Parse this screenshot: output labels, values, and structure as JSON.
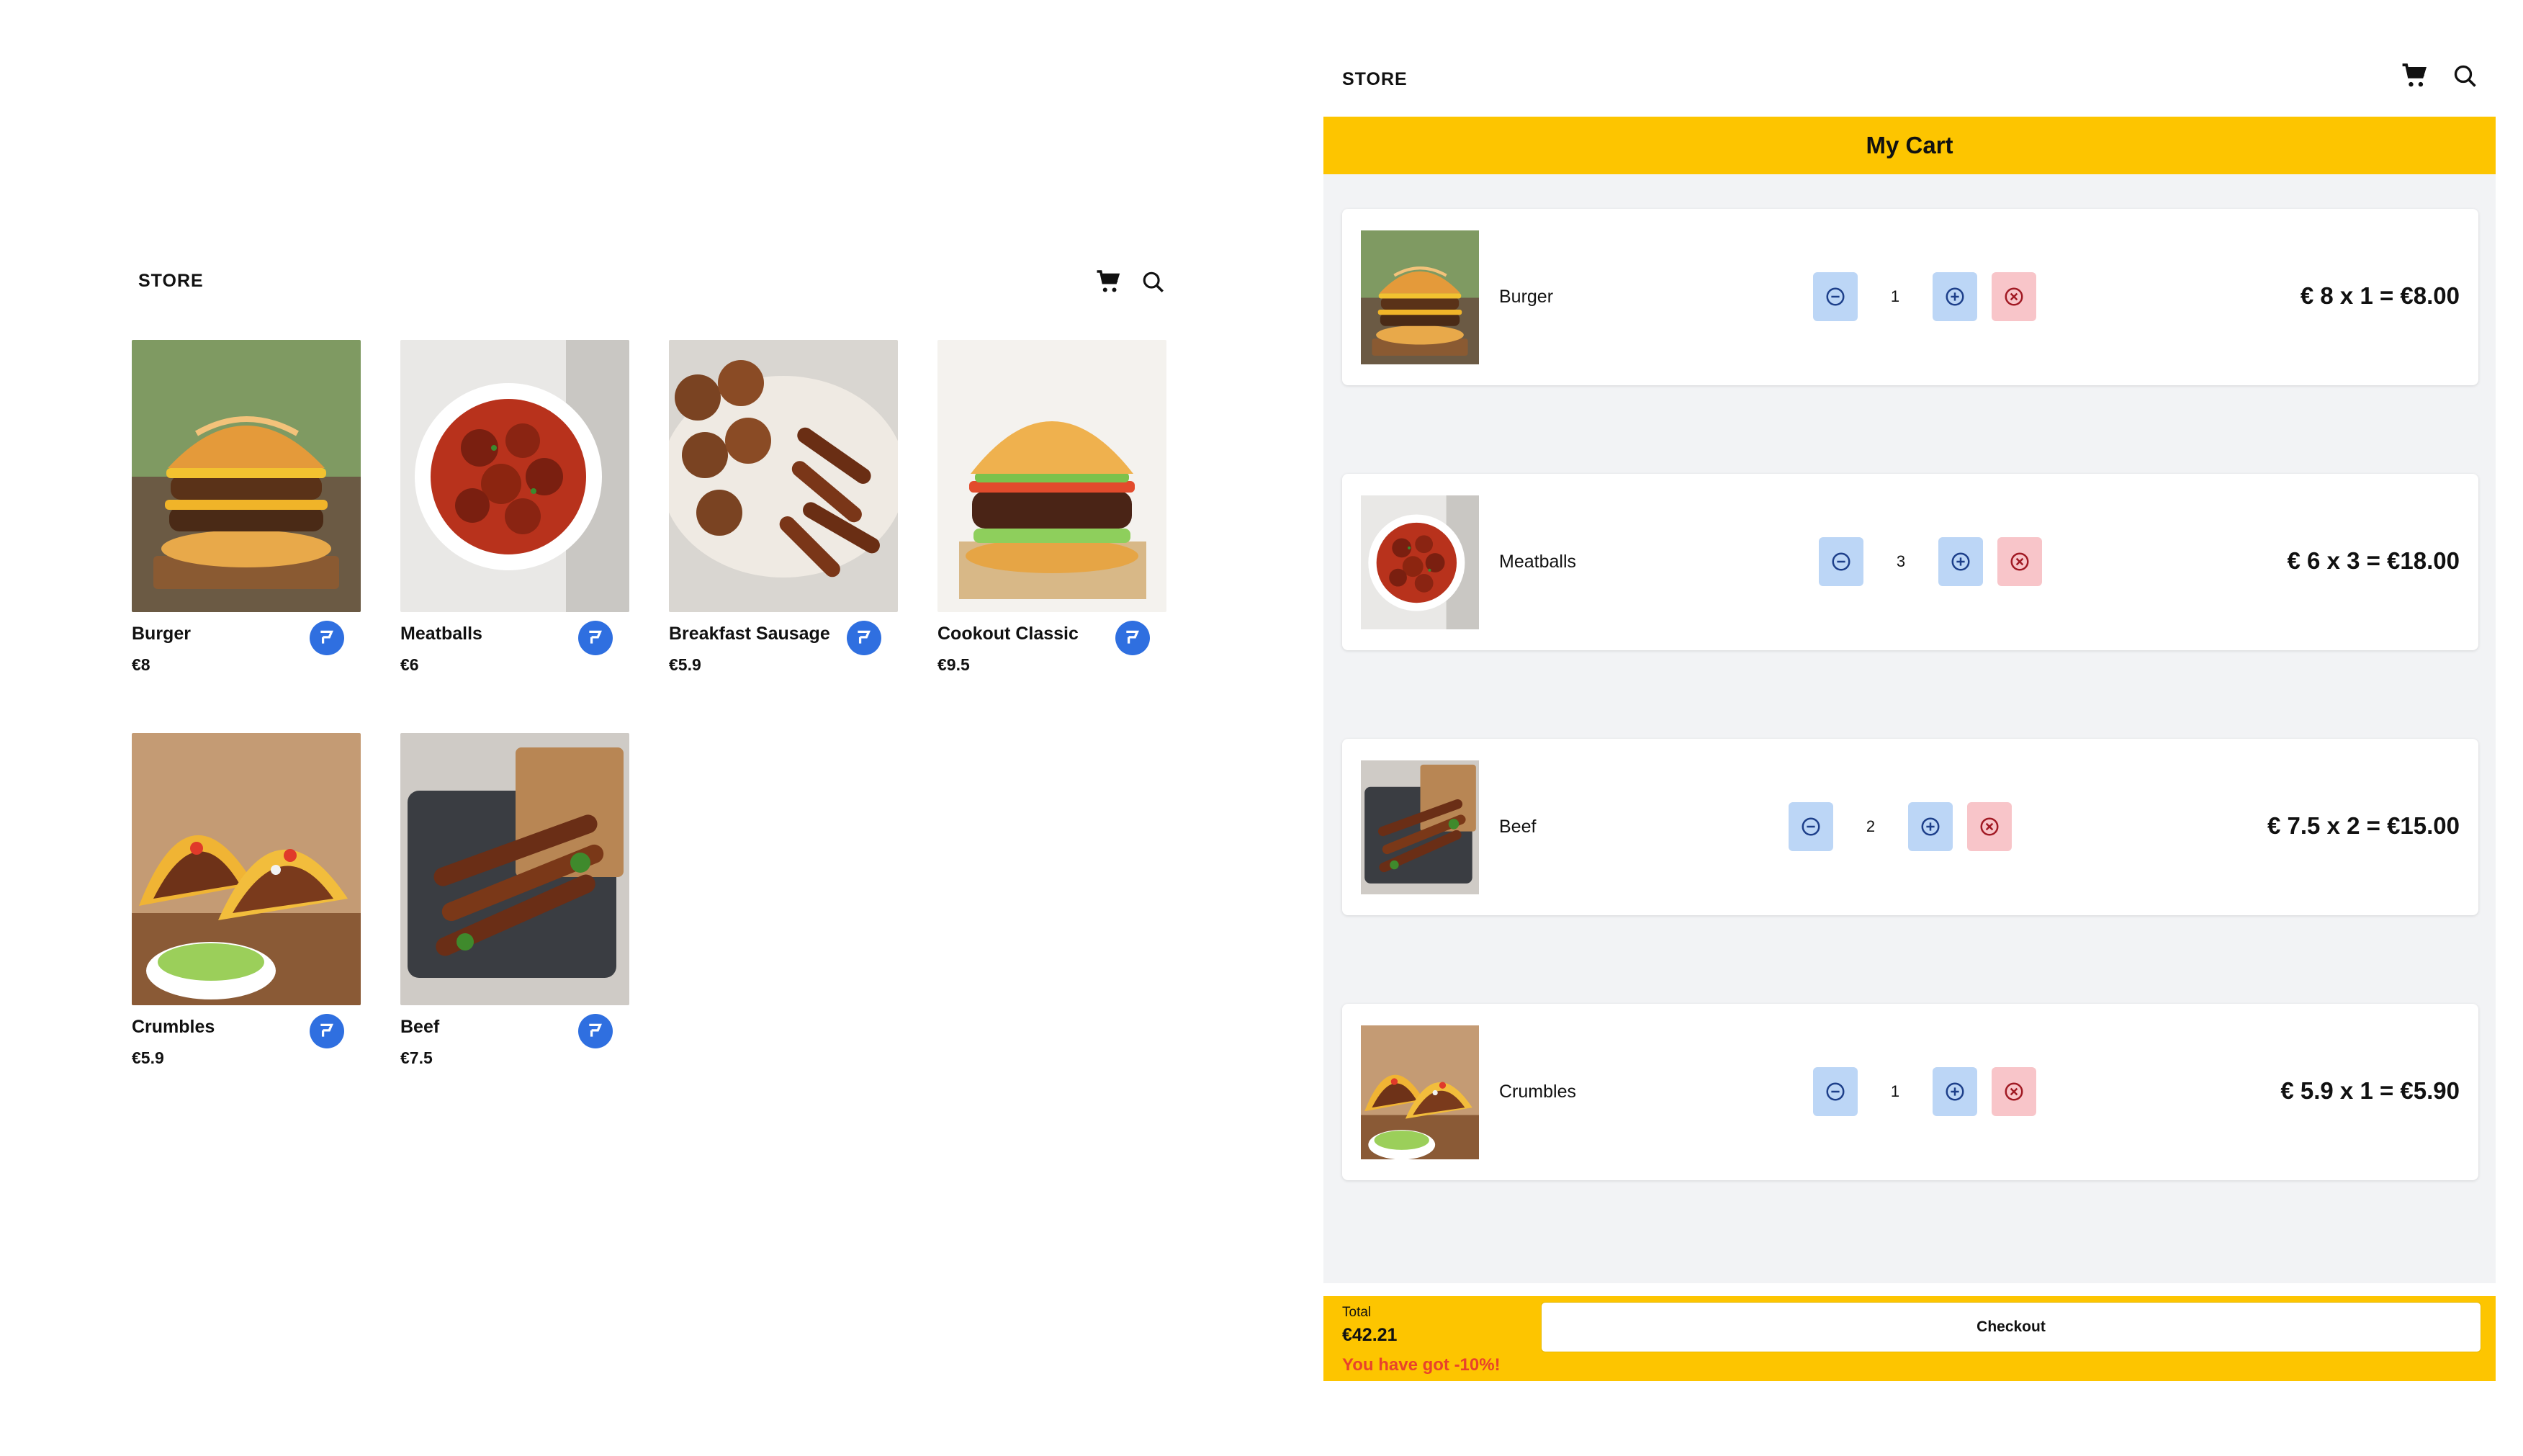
{
  "store": {
    "title": "STORE",
    "icons": [
      "cart-icon",
      "search-icon"
    ],
    "products": [
      {
        "name": "Burger",
        "price": "€8",
        "image": "burger"
      },
      {
        "name": "Meatballs",
        "price": "€6",
        "image": "meatballs"
      },
      {
        "name": "Breakfast Sausage",
        "price": "€5.9",
        "image": "sausage"
      },
      {
        "name": "Cookout Classic",
        "price": "€9.5",
        "image": "classic"
      },
      {
        "name": "Crumbles",
        "price": "€5.9",
        "image": "tacos"
      },
      {
        "name": "Beef",
        "price": "€7.5",
        "image": "kebab"
      }
    ]
  },
  "cart": {
    "store_title": "STORE",
    "heading": "My Cart",
    "items": [
      {
        "name": "Burger",
        "quantity": "1",
        "line": "€ 8 x 1 = €8.00",
        "image": "burger"
      },
      {
        "name": "Meatballs",
        "quantity": "3",
        "line": "€ 6 x 3 = €18.00",
        "image": "meatballs"
      },
      {
        "name": "Beef",
        "quantity": "2",
        "line": "€ 7.5 x 2 = €15.00",
        "image": "kebab"
      },
      {
        "name": "Crumbles",
        "quantity": "1",
        "line": "€ 5.9 x 1 = €5.90",
        "image": "tacos"
      }
    ],
    "footer": {
      "total_label": "Total",
      "total_value": "€42.21",
      "discount_text": "You have got -10%!",
      "checkout_label": "Checkout"
    }
  },
  "colors": {
    "accent_yellow": "#fdc500",
    "add_button_blue": "#2f6fe0",
    "qty_button_blue": "#bcd6f6",
    "remove_button_red": "#f8c5c9",
    "discount_red": "#e8432b"
  }
}
